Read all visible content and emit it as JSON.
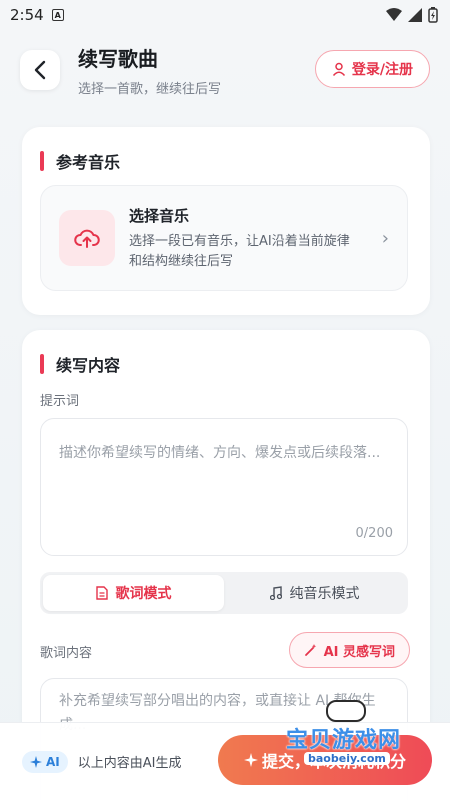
{
  "status_bar": {
    "time": "2:54",
    "sim_letter": "A"
  },
  "header": {
    "title": "续写歌曲",
    "subtitle": "选择一首歌，继续往后写",
    "login_label": "登录/注册"
  },
  "reference_section": {
    "title": "参考音乐",
    "select_title": "选择音乐",
    "select_desc": "选择一段已有音乐，让AI沿着当前旋律和结构继续往后写"
  },
  "continuation_section": {
    "title": "续写内容",
    "prompt_label": "提示词",
    "prompt_placeholder": "描述你希望续写的情绪、方向、爆发点或后续段落...",
    "char_count": "0/200",
    "modes": [
      {
        "label": "歌词模式",
        "active": true
      },
      {
        "label": "纯音乐模式",
        "active": false
      }
    ],
    "lyrics_label": "歌词内容",
    "ai_button_label": "AI 灵感写词",
    "lyrics_placeholder": "补充希望续写部分唱出的内容，或直接让 AI 帮你生成..."
  },
  "bottom_bar": {
    "ai_badge": "AI",
    "disclaimer": "以上内容由AI生成",
    "submit_label": "提交，本次消耗积分"
  },
  "watermark": {
    "text": "宝贝游戏网",
    "url": "baobeiy.com"
  },
  "colors": {
    "accent": "#e5344b",
    "submit_gradient_start": "#f07a4f",
    "submit_gradient_end": "#ef4b57"
  }
}
